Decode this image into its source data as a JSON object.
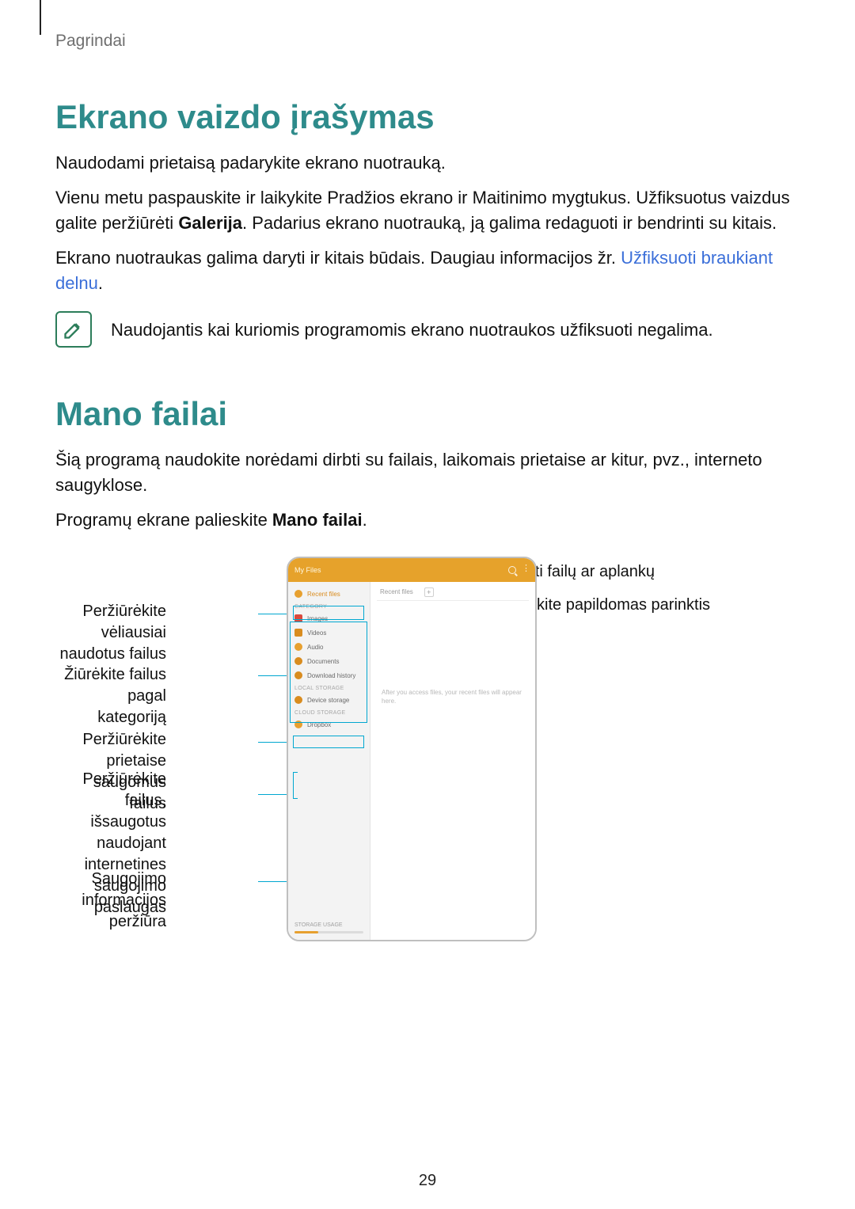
{
  "breadcrumb": "Pagrindai",
  "page_number": "29",
  "sec1": {
    "title": "Ekrano vaizdo įrašymas",
    "p1": "Naudodami prietaisą padarykite ekrano nuotrauką.",
    "p2_a": "Vienu metu paspauskite ir laikykite Pradžios ekrano ir Maitinimo mygtukus. Užfiksuotus vaizdus galite peržiūrėti ",
    "p2_b_bold": "Galerija",
    "p2_c": ". Padarius ekrano nuotrauką, ją galima redaguoti ir bendrinti su kitais.",
    "p3_a": "Ekrano nuotraukas galima daryti ir kitais būdais. Daugiau informacijos žr. ",
    "p3_link": "Užfiksuoti braukiant delnu",
    "p3_c": ".",
    "note": "Naudojantis kai kuriomis programomis ekrano nuotraukos užfiksuoti negalima."
  },
  "sec2": {
    "title": "Mano failai",
    "p1": "Šią programą naudokite norėdami dirbti su failais, laikomais prietaise ar kitur, pvz., interneto saugyklose.",
    "p2_a": "Programų ekrane palieskite ",
    "p2_b_bold": "Mano failai",
    "p2_c": "."
  },
  "screenshot": {
    "titlebar": "My Files",
    "sidebar": {
      "recent": "Recent files",
      "category_label": "Category",
      "images": "Images",
      "videos": "Videos",
      "audio": "Audio",
      "documents": "Documents",
      "download_history": "Download history",
      "local_label": "Local storage",
      "device_storage": "Device storage",
      "cloud_label": "Cloud storage",
      "cloud_item": "Dropbox",
      "storage_label": "STORAGE USAGE"
    },
    "content": {
      "tab1": "Recent files",
      "plus": "+",
      "message": "After you access files, your recent files will appear here."
    }
  },
  "callouts": {
    "left1": "Peržiūrėkite vėliausiai naudotus failus",
    "left2": "Žiūrėkite failus pagal kategoriją",
    "left3": "Peržiūrėkite prietaise saugomus failus",
    "left4": "Peržiūrėkite failus, išsaugotus naudojant internetines saugojimo paslaugas",
    "left5": "Saugojimo informacijos peržiūra",
    "right1": "Ieškoti failų ar aplankų",
    "right2": "Pasiekite papildomas parinktis"
  }
}
